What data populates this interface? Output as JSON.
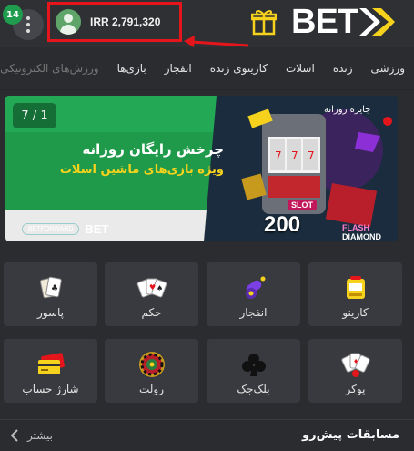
{
  "header": {
    "notification_count": "14",
    "balance": "IRR 2,791,320",
    "logo_text": "BET",
    "highlight_color": "#e5161b",
    "accent_color": "#f6d21d"
  },
  "nav": {
    "items": [
      "ورزشی",
      "زنده",
      "اسلات",
      "کازینوی زنده",
      "انفجار",
      "بازی‌ها",
      "ورزش‌های الکترونیکی"
    ]
  },
  "banner": {
    "counter": "7 / 1",
    "title": "چرخش رایگان روزانه",
    "subtitle": "ویژه بازی‌های ماشین اسلات",
    "partner": "BETFORWARD",
    "mini_logo": "BET",
    "number": "200",
    "slot_word": "SLOT",
    "flash_line1": "FLASH",
    "flash_line2": "DIAMOND",
    "corner_tag": "جایزه روزانه"
  },
  "tiles": [
    {
      "label": "کازینو",
      "icon": "slot-machine-icon"
    },
    {
      "label": "انفجار",
      "icon": "cannon-icon"
    },
    {
      "label": "حکم",
      "icon": "cards-fan-icon"
    },
    {
      "label": "پاسور",
      "icon": "playing-cards-icon"
    },
    {
      "label": "پوکر",
      "icon": "poker-hand-icon"
    },
    {
      "label": "بلک‌جک",
      "icon": "club-suit-icon"
    },
    {
      "label": "رولت",
      "icon": "roulette-wheel-icon"
    },
    {
      "label": "شارژ حساب",
      "icon": "credit-card-icon"
    }
  ],
  "bottom": {
    "title": "مسابقات پیش‌رو",
    "more_label": "بیشتر"
  }
}
